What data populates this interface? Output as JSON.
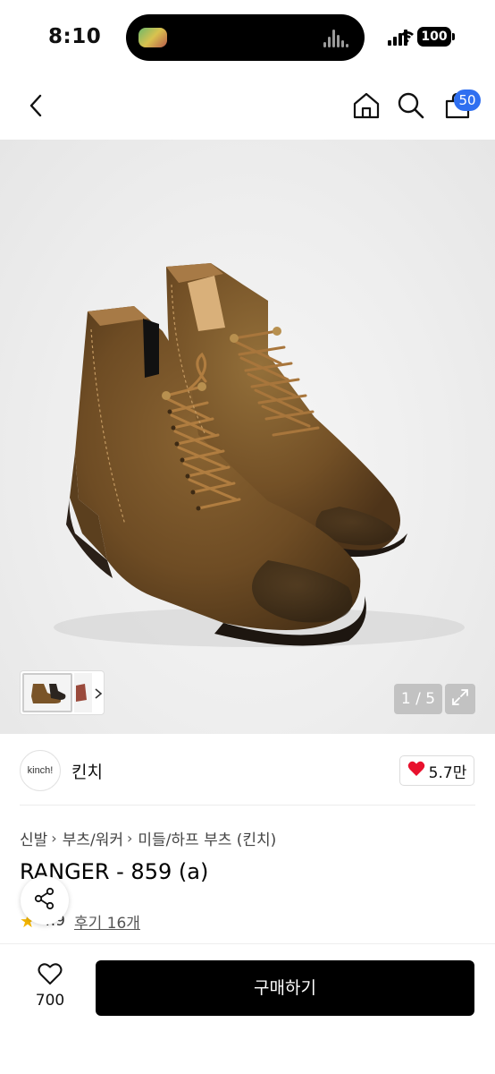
{
  "status_bar": {
    "time": "8:10",
    "battery": "100"
  },
  "nav": {
    "cart_count": "50"
  },
  "icons": {
    "back": "back-chevron-icon",
    "home": "home-icon",
    "search": "search-icon",
    "cart": "shopping-bag-icon",
    "expand": "expand-icon",
    "share": "share-icon",
    "wishlist": "heart-outline-icon",
    "like": "heart-filled-icon",
    "star": "star-icon"
  },
  "gallery": {
    "page_indicator": "1 / 5"
  },
  "brand": {
    "logo_text": "kinch!",
    "name": "킨치",
    "likes": "5.7만"
  },
  "breadcrumb": [
    "신발",
    "부츠/워커",
    "미들/하프 부츠 (킨치)"
  ],
  "product": {
    "title": "RANGER - 859 (a)",
    "rating": "4.9",
    "reviews": "후기 16개"
  },
  "bottom_bar": {
    "wish_count": "700",
    "buy_label": "구매하기"
  },
  "colors": {
    "accent_blue": "#2f6ff0",
    "like_red": "#e8112d",
    "star_yellow": "#f2b400",
    "buy_black": "#000000"
  }
}
